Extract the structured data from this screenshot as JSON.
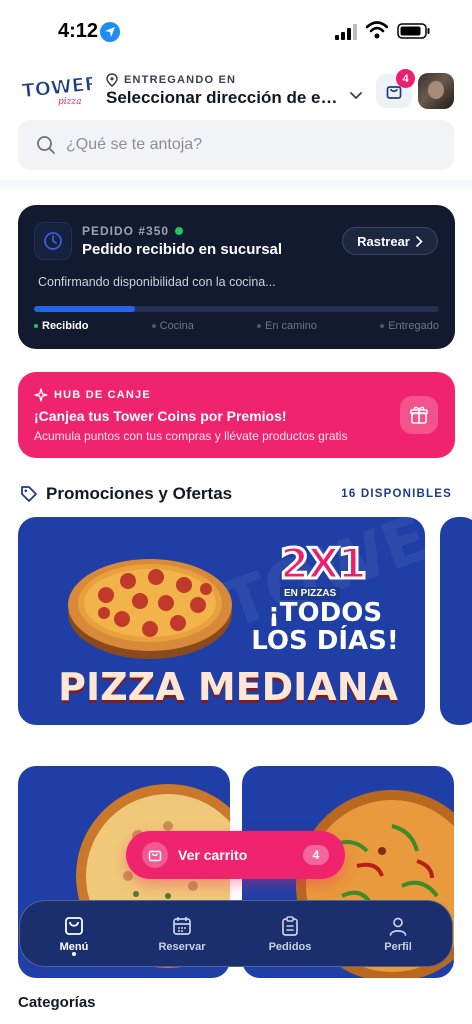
{
  "status_bar": {
    "time": "4:12"
  },
  "header": {
    "logo_text": "TOWER",
    "logo_sub": "pizza",
    "delivery_label": "ENTREGANDO EN",
    "delivery_address": "Seleccionar dirección de entrega",
    "cart_count": "4"
  },
  "search": {
    "placeholder": "¿Qué se te antoja?"
  },
  "order": {
    "number": "PEDIDO #350",
    "status": "Pedido recibido en sucursal",
    "track_label": "Rastrear",
    "description": "Confirmando disponibilidad con la cocina...",
    "progress": 0.25,
    "steps": [
      "Recibido",
      "Cocina",
      "En camino",
      "Entregado"
    ],
    "active_step": 0
  },
  "hub": {
    "label": "HUB DE CANJE",
    "title": "¡Canjea tus Tower Coins por Premios!",
    "description": "Acumula puntos con tus compras y llévate productos gratis"
  },
  "promotions": {
    "title": "Promociones y Ofertas",
    "count": "16 DISPONIBLES",
    "banner": {
      "badge": "2X1",
      "badge_sub": "EN PIZZAS",
      "line1": "¡TODOS",
      "line2": "LOS DÍAS!",
      "main": "PIZZA MEDIANA"
    }
  },
  "floating_cart": {
    "label": "Ver carrito",
    "count": "4"
  },
  "bottom_nav": {
    "items": [
      {
        "label": "Menú",
        "icon": "bag-icon"
      },
      {
        "label": "Reservar",
        "icon": "calendar-icon"
      },
      {
        "label": "Pedidos",
        "icon": "clipboard-icon"
      },
      {
        "label": "Perfil",
        "icon": "user-icon"
      }
    ],
    "active": 0
  },
  "categories_title": "Categorías",
  "colors": {
    "brand_pink": "#f0236e",
    "navy": "#111a2e",
    "promo_blue": "#1f3fa6",
    "success": "#22c55e"
  }
}
